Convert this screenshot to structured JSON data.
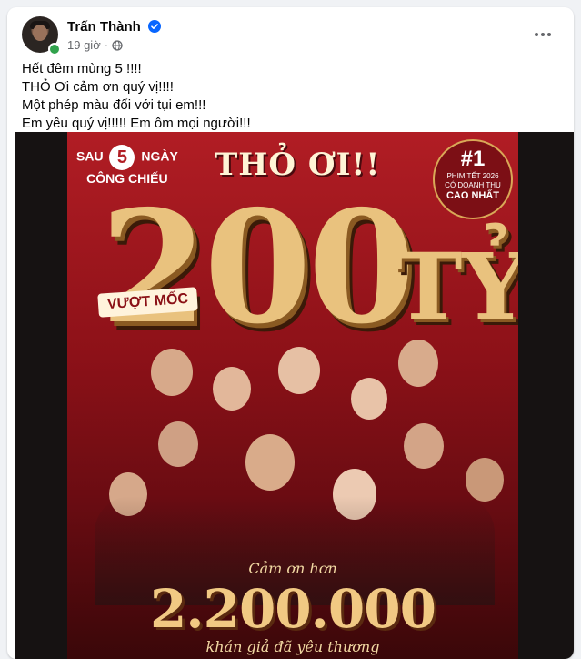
{
  "post": {
    "author": "Trấn Thành",
    "time": "19 giờ",
    "lines": [
      "Hết đêm mùng 5 !!!!",
      "THỎ Ơi cảm ơn quý vị!!!!",
      "Một phép màu đối với tụi em!!!",
      "Em yêu quý vị!!!!! Em ôm mọi người!!!"
    ]
  },
  "poster": {
    "sau": "SAU",
    "five": "5",
    "ngay": "NGÀY",
    "cong_chieu": "CÔNG CHIẾU",
    "logo": "THỎ ƠI!!",
    "badge_rank": "#1",
    "badge_line1": "PHIM TẾT 2026",
    "badge_line2": "CÓ DOANH THU",
    "badge_line3": "CAO NHẤT",
    "big_number": "200",
    "unit": "TỶ",
    "vuot_moc": "VƯỢT MỐC",
    "cam_on": "Cảm ơn hơn",
    "audience": "2.200.000",
    "audience_caption": "khán giả đã yêu thương"
  },
  "colors": {
    "accent_blue": "#0866ff",
    "online_green": "#31a24c",
    "poster_red": "#b11d24",
    "gold": "#e9c27e"
  },
  "icons": [
    "verified-badge-icon",
    "globe-icon",
    "more-options-icon"
  ]
}
